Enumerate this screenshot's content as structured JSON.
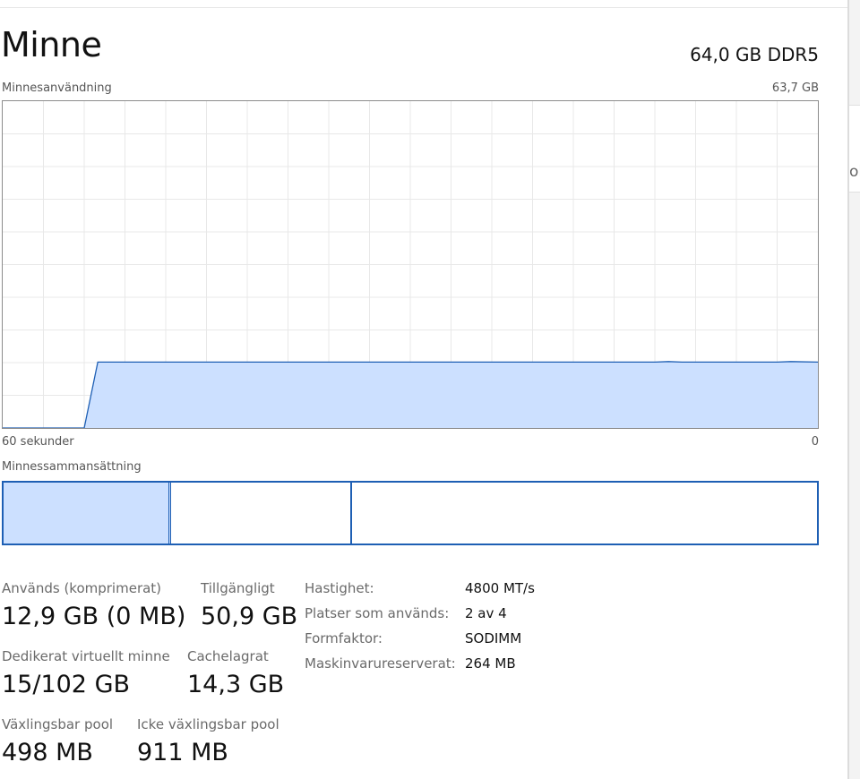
{
  "header": {
    "title": "Minne",
    "spec": "64,0 GB DDR5"
  },
  "usage_chart": {
    "label": "Minnesanvändning",
    "max_label": "63,7 GB",
    "x_left_label": "60 sekunder",
    "x_right_label": "0",
    "colors": {
      "fill": "#cce0ff",
      "line": "#1e5fb4",
      "grid": "#e8e8e8",
      "border": "#8c8c8c"
    }
  },
  "chart_data": {
    "type": "area",
    "xlabel": "",
    "ylabel": "",
    "x": [
      60,
      54,
      53,
      12,
      11,
      10,
      3,
      2,
      0
    ],
    "y": [
      0,
      0,
      12.85,
      12.85,
      12.95,
      12.85,
      12.85,
      12.95,
      12.85
    ],
    "xlim": [
      60,
      0
    ],
    "ylim": [
      0,
      63.7
    ],
    "grid": true
  },
  "composition": {
    "label": "Minnessammansättning",
    "segments": [
      {
        "name": "used",
        "fraction": 0.205
      },
      {
        "name": "modified",
        "fraction": 0.222
      },
      {
        "name": "standby",
        "fraction": 0.573
      }
    ]
  },
  "stats": {
    "in_use": {
      "label": "Används (komprimerat)",
      "value": "12,9 GB (0 MB)"
    },
    "available": {
      "label": "Tillgängligt",
      "value": "50,9 GB"
    },
    "committed": {
      "label": "Dedikerat virtuellt minne",
      "value": "15/102 GB"
    },
    "cached": {
      "label": "Cachelagrat",
      "value": "14,3 GB"
    },
    "paged_pool": {
      "label": "Växlingsbar pool",
      "value": "498 MB"
    },
    "non_paged_pool": {
      "label": "Icke växlingsbar pool",
      "value": "911 MB"
    }
  },
  "info": [
    {
      "label": "Hastighet:",
      "value": "4800 MT/s"
    },
    {
      "label": "Platser som används:",
      "value": "2 av 4"
    },
    {
      "label": "Formfaktor:",
      "value": "SODIMM"
    },
    {
      "label": "Maskinvarureserverat:",
      "value": "264 MB"
    }
  ],
  "side_panel": {
    "peek_text": "ol"
  }
}
